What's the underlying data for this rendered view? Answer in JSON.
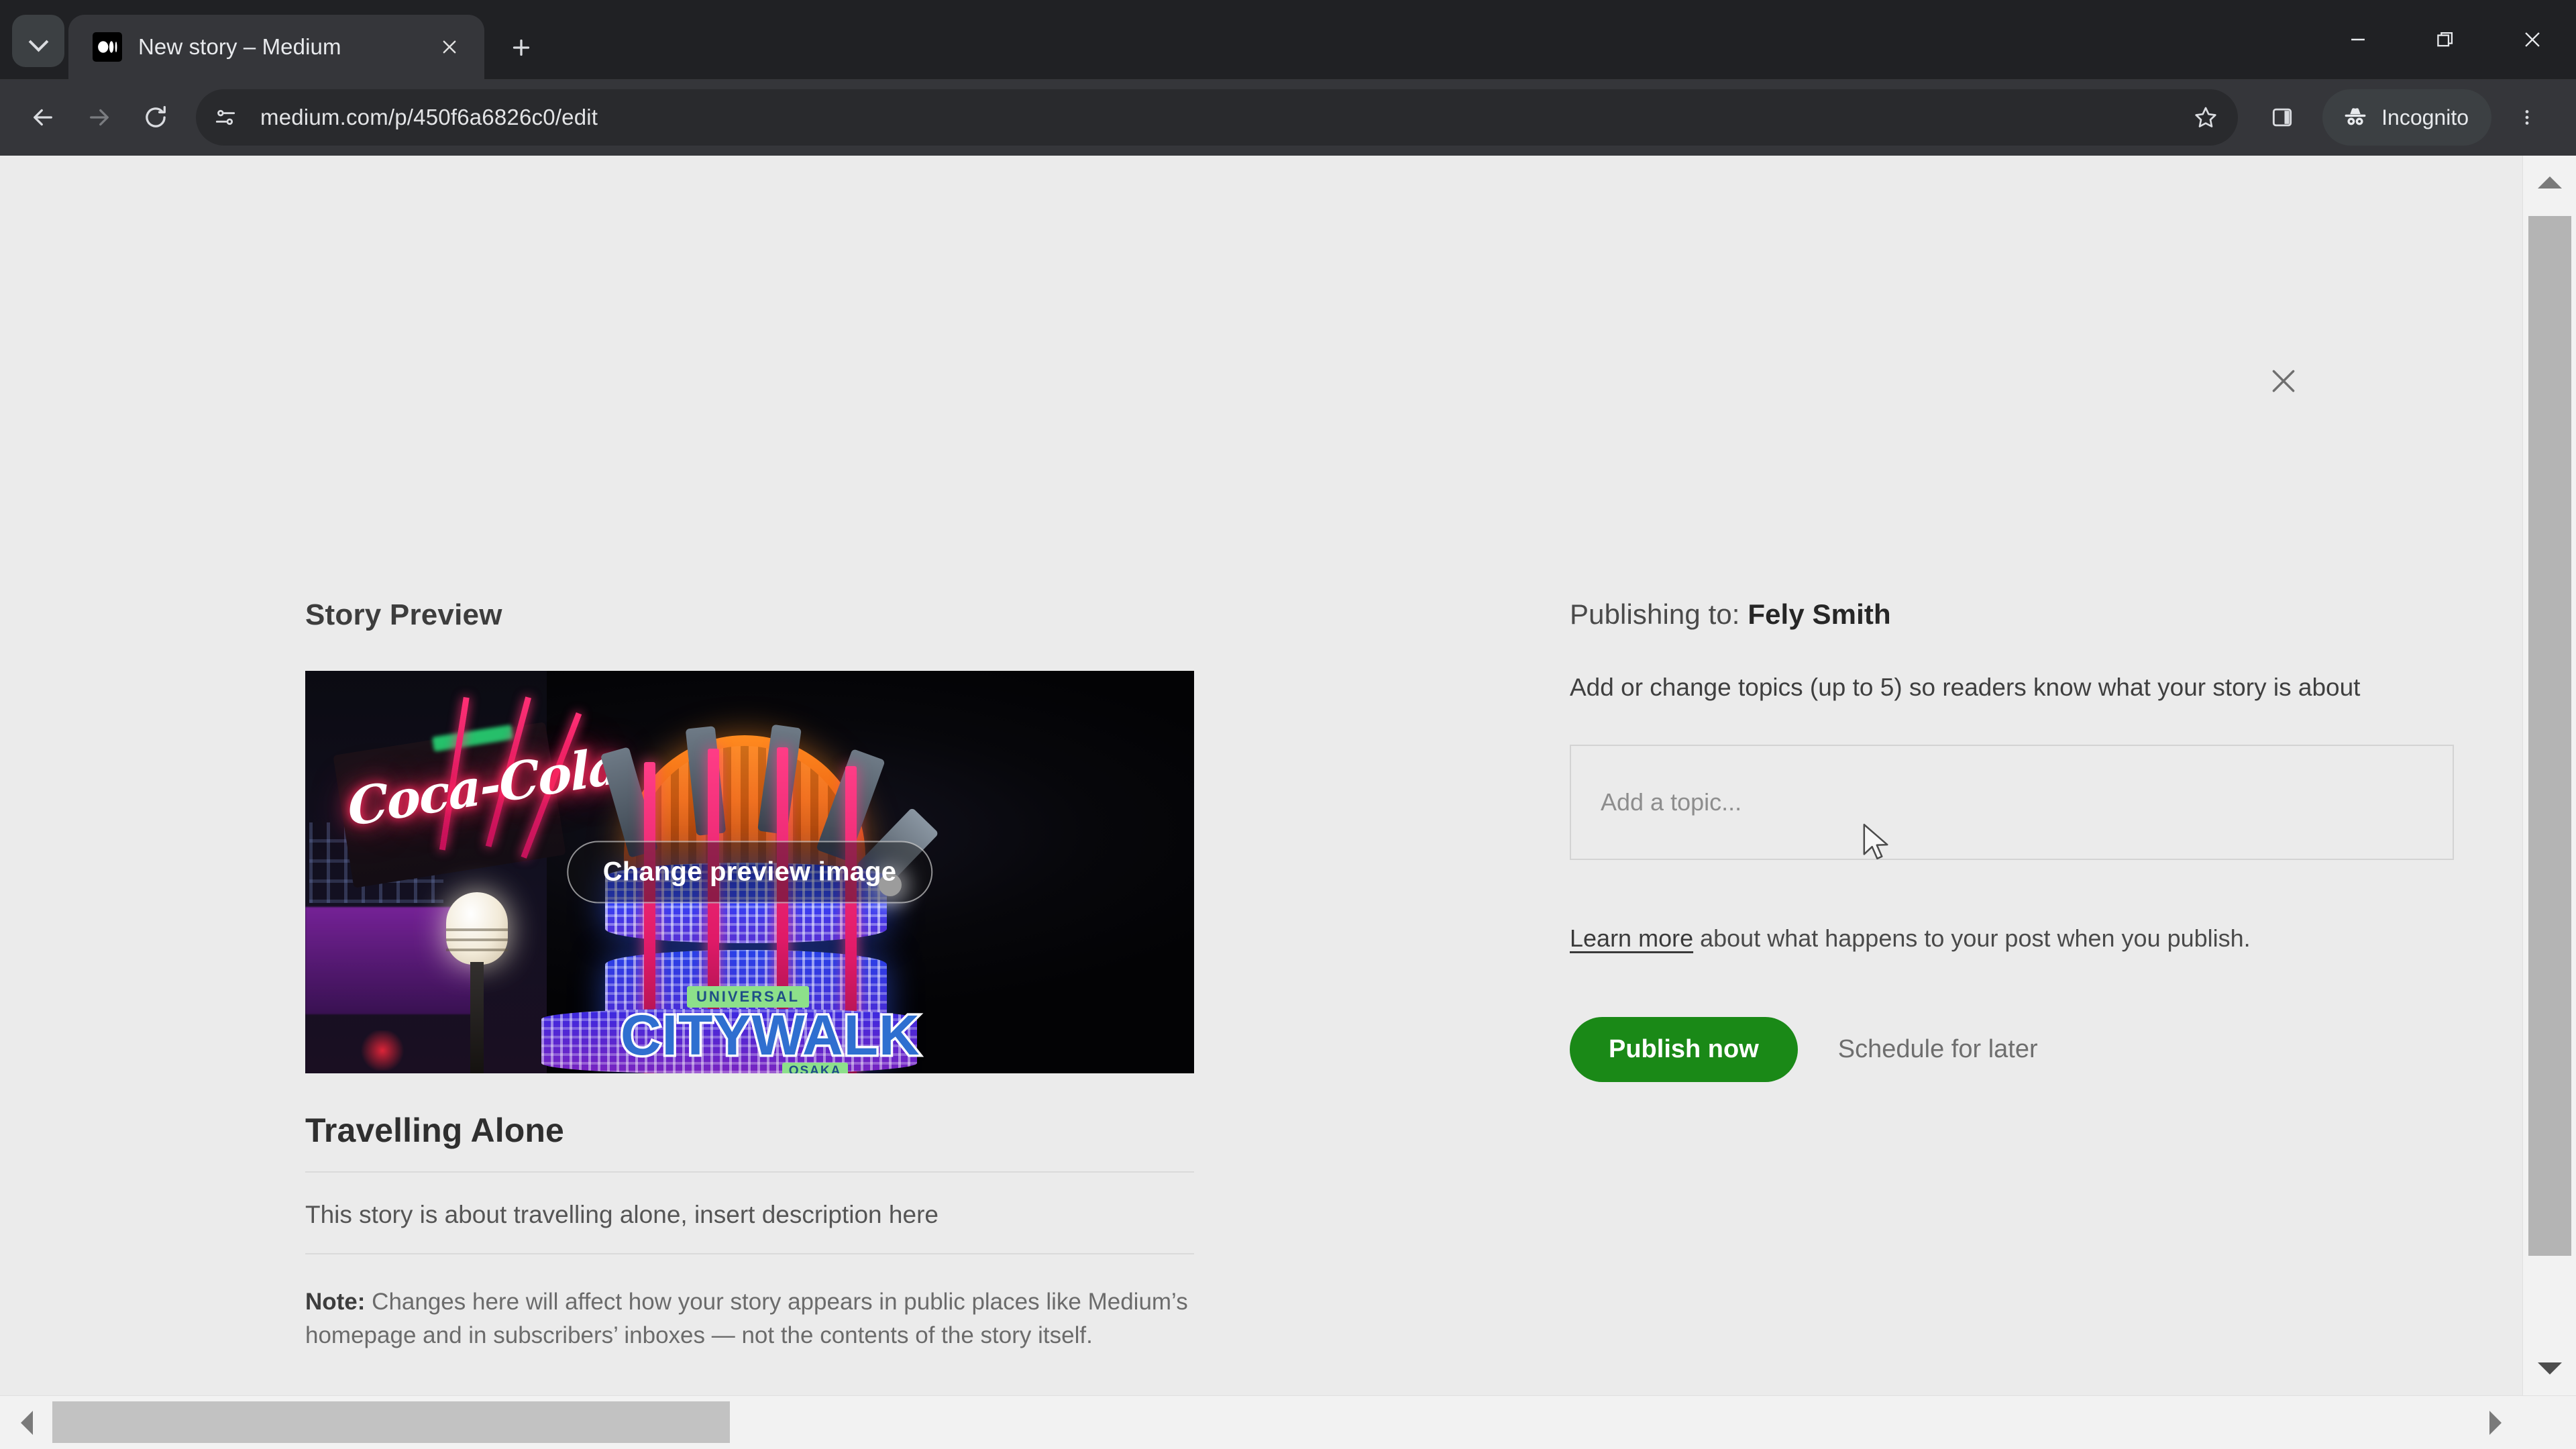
{
  "browser": {
    "tab": {
      "title": "New story – Medium",
      "favicon_name": "medium-logo-icon",
      "close_label": "×"
    },
    "new_tab_label": "+",
    "tab_list_label": "Search tabs",
    "nav": {
      "back_label": "Back",
      "forward_label": "Forward",
      "reload_label": "Reload"
    },
    "omnibox": {
      "url": "medium.com/p/450f6a6826c0/edit",
      "site_info_label": "View site information",
      "bookmark_label": "Bookmark this tab"
    },
    "side_panel_label": "Side panel",
    "incognito_label": "Incognito",
    "menu_label": "Customize and control Google Chrome",
    "window_controls": {
      "minimize_label": "Minimize",
      "restore_label": "Restore",
      "close_label": "Close"
    }
  },
  "page": {
    "close_label": "Close",
    "left": {
      "section_title": "Story Preview",
      "change_image_label": "Change preview image",
      "story_title": "Travelling Alone",
      "story_description": "This story is about travelling alone, insert description here",
      "note_label": "Note:",
      "note_text": " Changes here will affect how your story appears in public places like Medium’s homepage and in subscribers’ inboxes — not the contents of the story itself.",
      "preview_image": {
        "alt": "Night photo of Universal CityWalk Osaka with neon signs",
        "coca_cola_sign": "Coca-Cola",
        "universal_tag": "UNIVERSAL",
        "citywalk_word": "CITYWALK",
        "osaka_tag": "OSAKA"
      }
    },
    "right": {
      "publishing_prefix": "Publishing to: ",
      "publication_name": "Fely Smith",
      "topics_help": "Add or change topics (up to 5) so readers know what your story is about",
      "topic_placeholder": "Add a topic...",
      "topic_value": "",
      "learn_more_link": "Learn more",
      "learn_more_rest": " about what happens to your post when you publish.",
      "publish_now_label": "Publish now",
      "schedule_label": "Schedule for later"
    }
  },
  "colors": {
    "publish_green": "#1a8917",
    "page_bg": "#ebebeb",
    "chrome_bg": "#202124",
    "toolbar_bg": "#35363a"
  }
}
